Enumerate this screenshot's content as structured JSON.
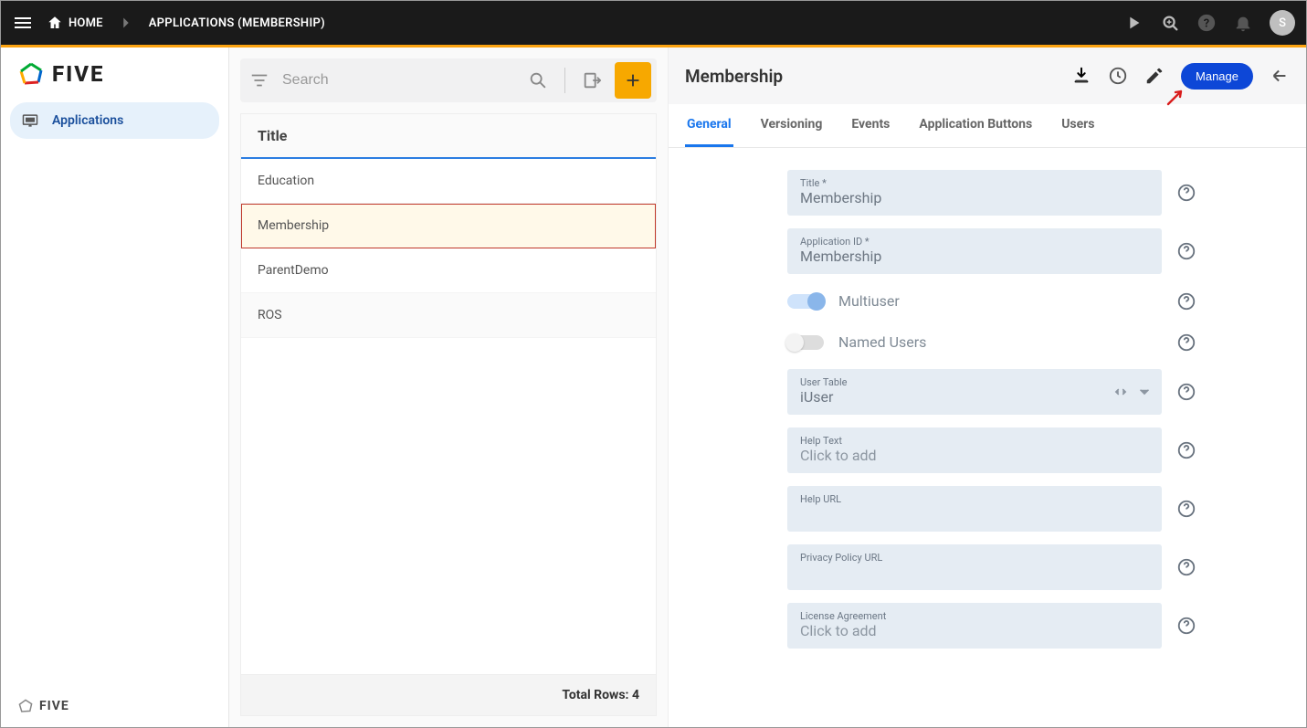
{
  "topbar": {
    "home": "HOME",
    "crumb": "APPLICATIONS (MEMBERSHIP)",
    "avatar": "S"
  },
  "sidebar": {
    "brand": "FIVE",
    "nav": {
      "applications": "Applications"
    },
    "footer": "FIVE"
  },
  "list": {
    "search_placeholder": "Search",
    "header": "Title",
    "rows": [
      "Education",
      "Membership",
      "ParentDemo",
      "ROS"
    ],
    "selected_index": 1,
    "footer_label": "Total Rows:",
    "footer_count": "4"
  },
  "detail": {
    "title": "Membership",
    "manage": "Manage",
    "tabs": [
      "General",
      "Versioning",
      "Events",
      "Application Buttons",
      "Users"
    ],
    "active_tab": 0,
    "fields": {
      "title_label": "Title *",
      "title_value": "Membership",
      "appid_label": "Application ID *",
      "appid_value": "Membership",
      "multiuser_label": "Multiuser",
      "namedusers_label": "Named Users",
      "usertable_label": "User Table",
      "usertable_value": "iUser",
      "helptext_label": "Help Text",
      "helptext_ph": "Click to add",
      "helpurl_label": "Help URL",
      "privacy_label": "Privacy Policy URL",
      "license_label": "License Agreement",
      "license_ph": "Click to add"
    }
  }
}
